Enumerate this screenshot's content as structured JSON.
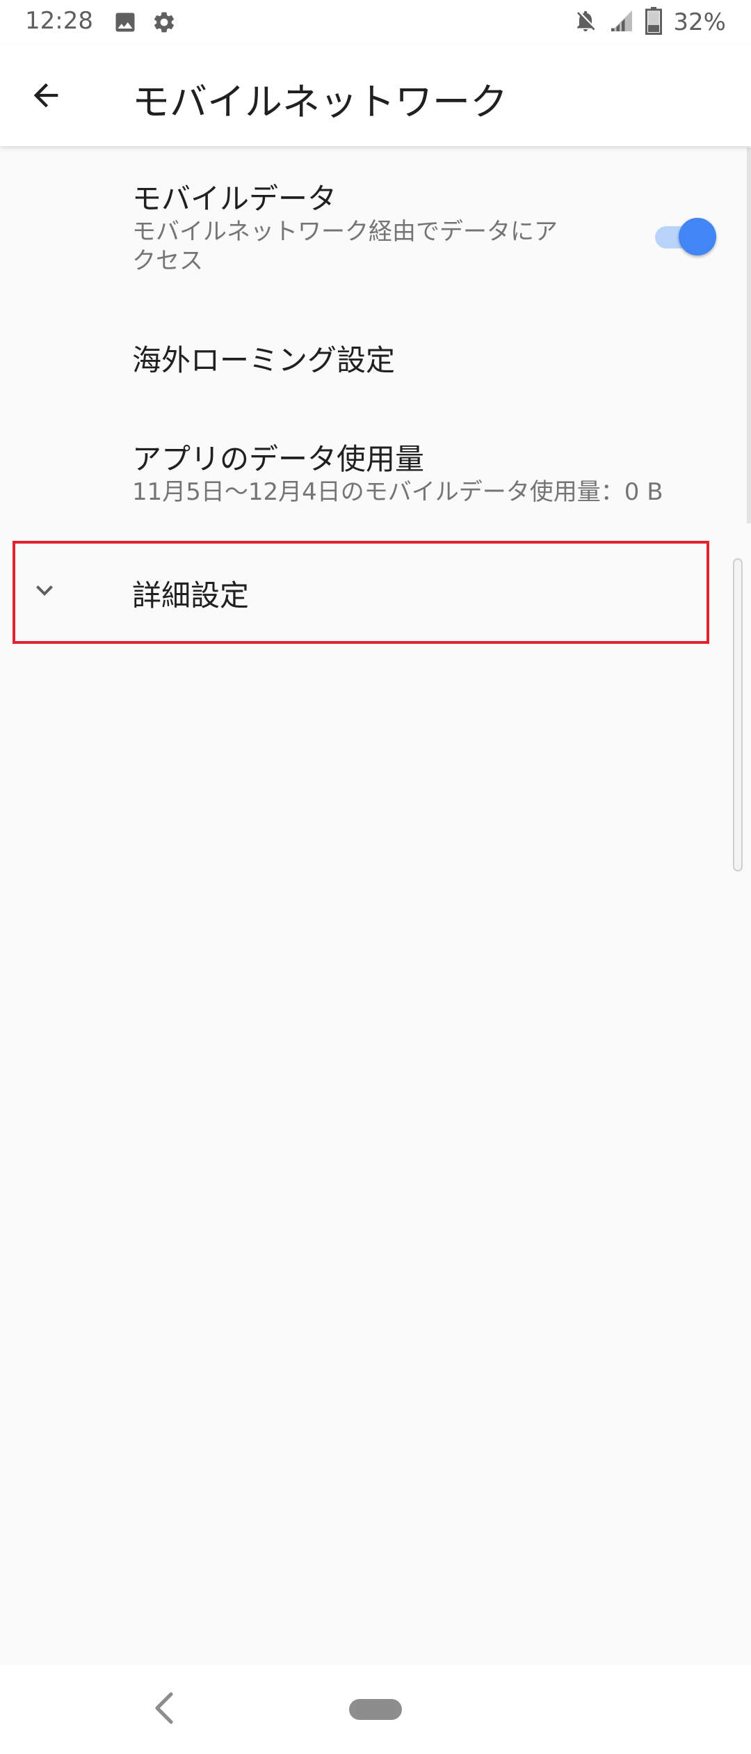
{
  "status_bar": {
    "time": "12:28",
    "battery_text": "32%",
    "icons": [
      "image-icon",
      "gear-icon",
      "notifications-off-icon",
      "signal-icon",
      "battery-icon"
    ]
  },
  "app_bar": {
    "title": "モバイルネットワーク",
    "back_icon": "back-arrow-icon"
  },
  "preferences": {
    "mobile_data": {
      "title": "モバイルデータ",
      "summary_line1": "モバイルネットワーク経由でデータにア",
      "summary_line2": "クセス",
      "enabled": true
    },
    "roaming": {
      "title": "海外ローミング設定"
    },
    "app_data_usage": {
      "title": "アプリのデータ使用量",
      "summary": "11月5日～12月4日のモバイルデータ使用量：0 B"
    },
    "advanced": {
      "title": "詳細設定",
      "icon": "chevron-down-icon"
    }
  },
  "colors": {
    "accent": "#4285f4",
    "accent_track": "#b9d4fb",
    "highlight": "#e0232e",
    "background": "#fafafa"
  },
  "nav_bar": {
    "icons": [
      "nav-back-icon",
      "nav-home-pill"
    ]
  }
}
